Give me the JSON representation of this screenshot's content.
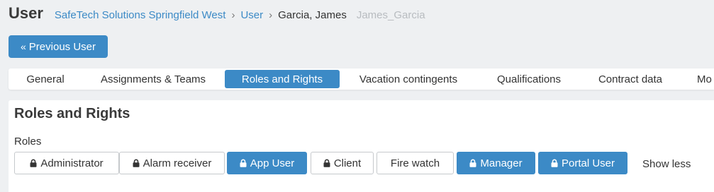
{
  "header": {
    "title": "User",
    "breadcrumb": {
      "company": "SafeTech Solutions Springfield West",
      "section": "User",
      "current": "Garcia, James",
      "login": "James_Garcia"
    }
  },
  "actions": {
    "previous_user_label": "Previous User"
  },
  "tabs": [
    {
      "label": "General"
    },
    {
      "label": "Assignments & Teams"
    },
    {
      "label": "Roles and Rights",
      "active": true
    },
    {
      "label": "Vacation contingents"
    },
    {
      "label": "Qualifications"
    },
    {
      "label": "Contract data"
    },
    {
      "label": "Mo"
    }
  ],
  "roles_panel": {
    "title": "Roles and Rights",
    "roles_label": "Roles",
    "roles": [
      {
        "label": "Administrator",
        "locked": true,
        "selected": false
      },
      {
        "label": "Alarm receiver",
        "locked": true,
        "selected": false
      },
      {
        "label": "App User",
        "locked": true,
        "selected": true
      },
      {
        "label": "Client",
        "locked": true,
        "selected": false
      },
      {
        "label": "Fire watch",
        "locked": false,
        "selected": false
      },
      {
        "label": "Manager",
        "locked": true,
        "selected": true
      },
      {
        "label": "Portal User",
        "locked": true,
        "selected": true
      }
    ],
    "show_less_label": "Show less"
  },
  "colors": {
    "accent": "#3c8ac6",
    "background": "#eef0f2",
    "login_muted": "#b8bcc0"
  },
  "icons": {
    "previous": "double-chevron-left-icon",
    "lock": "lock-icon",
    "breadcrumb_separator": "chevron-right-icon"
  }
}
